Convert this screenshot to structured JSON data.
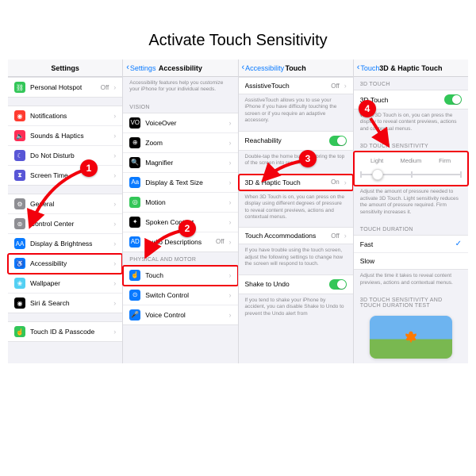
{
  "title": "Activate Touch Sensitivity",
  "panel1": {
    "header": "Settings",
    "rows": [
      {
        "icon": "#33c658",
        "glyph": "⛓",
        "label": "Personal Hotspot",
        "val": "Off"
      },
      {
        "spacer": true
      },
      {
        "icon": "#ff3b30",
        "glyph": "◉",
        "label": "Notifications"
      },
      {
        "icon": "#ff2d55",
        "glyph": "🔈",
        "label": "Sounds & Haptics"
      },
      {
        "icon": "#5856d6",
        "glyph": "☾",
        "label": "Do Not Disturb"
      },
      {
        "icon": "#5856d6",
        "glyph": "⧗",
        "label": "Screen Time"
      },
      {
        "spacer": true
      },
      {
        "icon": "#8e8e93",
        "glyph": "⚙",
        "label": "General"
      },
      {
        "icon": "#8e8e93",
        "glyph": "⊚",
        "label": "Control Center"
      },
      {
        "icon": "#0a7aff",
        "glyph": "AA",
        "label": "Display & Brightness"
      },
      {
        "icon": "#0a7aff",
        "glyph": "♿",
        "label": "Accessibility",
        "hl": true
      },
      {
        "icon": "#53d0f3",
        "glyph": "❀",
        "label": "Wallpaper"
      },
      {
        "icon": "#000",
        "glyph": "◉",
        "label": "Siri & Search"
      },
      {
        "spacer": true
      },
      {
        "icon": "#33c658",
        "glyph": "☝",
        "label": "Touch ID & Passcode"
      }
    ]
  },
  "panel2": {
    "back": "Settings",
    "header": "Accessibility",
    "lead": "Accessibility features help you customize your iPhone for your individual needs.",
    "sec1": "VISION",
    "vision": [
      {
        "icon": "#000",
        "glyph": "VO",
        "label": "VoiceOver"
      },
      {
        "icon": "#000",
        "glyph": "⊕",
        "label": "Zoom"
      },
      {
        "icon": "#000",
        "glyph": "🔍",
        "label": "Magnifier"
      },
      {
        "icon": "#0a7aff",
        "glyph": "Aa",
        "label": "Display & Text Size"
      },
      {
        "icon": "#33c658",
        "glyph": "◎",
        "label": "Motion"
      },
      {
        "icon": "#000",
        "glyph": "✦",
        "label": "Spoken Content"
      },
      {
        "icon": "#0a7aff",
        "glyph": "AD",
        "label": "Audio Descriptions",
        "val": "Off"
      }
    ],
    "sec2": "PHYSICAL AND MOTOR",
    "motor": [
      {
        "icon": "#0a7aff",
        "glyph": "☝",
        "label": "Touch",
        "hl": true
      },
      {
        "icon": "#0a7aff",
        "glyph": "⊙",
        "label": "Switch Control"
      },
      {
        "icon": "#0a7aff",
        "glyph": "🎤",
        "label": "Voice Control"
      }
    ]
  },
  "panel3": {
    "back": "Accessibility",
    "header": "Touch",
    "at": {
      "label": "AssistiveTouch",
      "val": "Off",
      "desc": "AssistiveTouch allows you to use your iPhone if you have difficulty touching the screen or if you require an adaptive accessory."
    },
    "reach": {
      "label": "Reachability",
      "on": true,
      "desc": "Double-tap the home button to bring the top of the screen into reach."
    },
    "haptic": {
      "label": "3D & Haptic Touch",
      "val": "On",
      "desc": "When 3D Touch is on, you can press on the display using different degrees of pressure to reveal content previews, actions and contextual menus."
    },
    "accom": {
      "label": "Touch Accommodations",
      "val": "Off",
      "desc": "If you have trouble using the touch screen, adjust the following settings to change how the screen will respond to touch."
    },
    "shake": {
      "label": "Shake to Undo",
      "on": true,
      "desc": "If you tend to shake your iPhone by accident, you can disable Shake to Undo to prevent the Undo alert from"
    }
  },
  "panel4": {
    "back": "Touch",
    "header": "3D & Haptic Touch",
    "sec_3d": "3D TOUCH",
    "sw_3d": "3D Touch",
    "desc_3d": "When 3D Touch is on, you can press the display to reveal content previews, actions and contextual menus.",
    "sec_sens": "3D TOUCH SENSITIVITY",
    "seg": [
      "Light",
      "Medium",
      "Firm"
    ],
    "desc_sens": "Adjust the amount of pressure needed to activate 3D Touch. Light sensitivity reduces the amount of pressure required. Firm sensitivity increases it.",
    "sec_dur": "TOUCH DURATION",
    "dur": [
      "Fast",
      "Slow"
    ],
    "desc_dur": "Adjust the time it takes to reveal content previews, actions and contextual menus.",
    "sec_test": "3D TOUCH SENSITIVITY AND TOUCH DURATION TEST"
  },
  "ann": {
    "b1": "1",
    "b2": "2",
    "b3": "3",
    "b4": "4"
  }
}
